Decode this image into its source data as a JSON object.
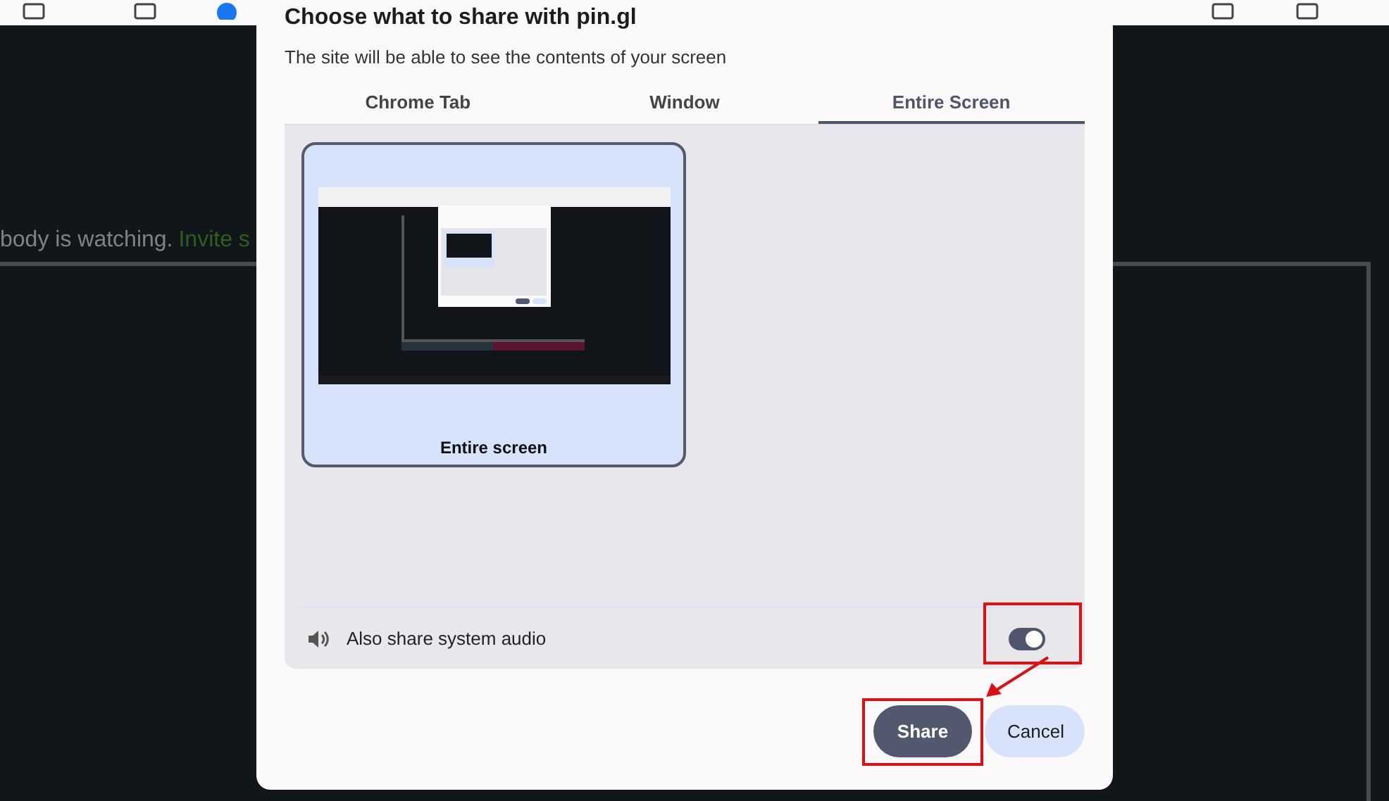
{
  "page": {
    "notice": "body is watching.",
    "link": "Invite s"
  },
  "dialog": {
    "title": "Choose what to share with pin.gl",
    "subtitle": "The site will be able to see the contents of your screen",
    "tabs": [
      {
        "label": "Chrome Tab",
        "selected": false
      },
      {
        "label": "Window",
        "selected": false
      },
      {
        "label": "Entire Screen",
        "selected": true
      }
    ],
    "sources": [
      {
        "label": "Entire screen",
        "selected": true
      }
    ],
    "audio": {
      "label": "Also share system audio",
      "on": true
    },
    "buttons": [
      {
        "label": "Share",
        "kind": "primary"
      },
      {
        "label": "Cancel",
        "kind": "secondary"
      }
    ]
  }
}
